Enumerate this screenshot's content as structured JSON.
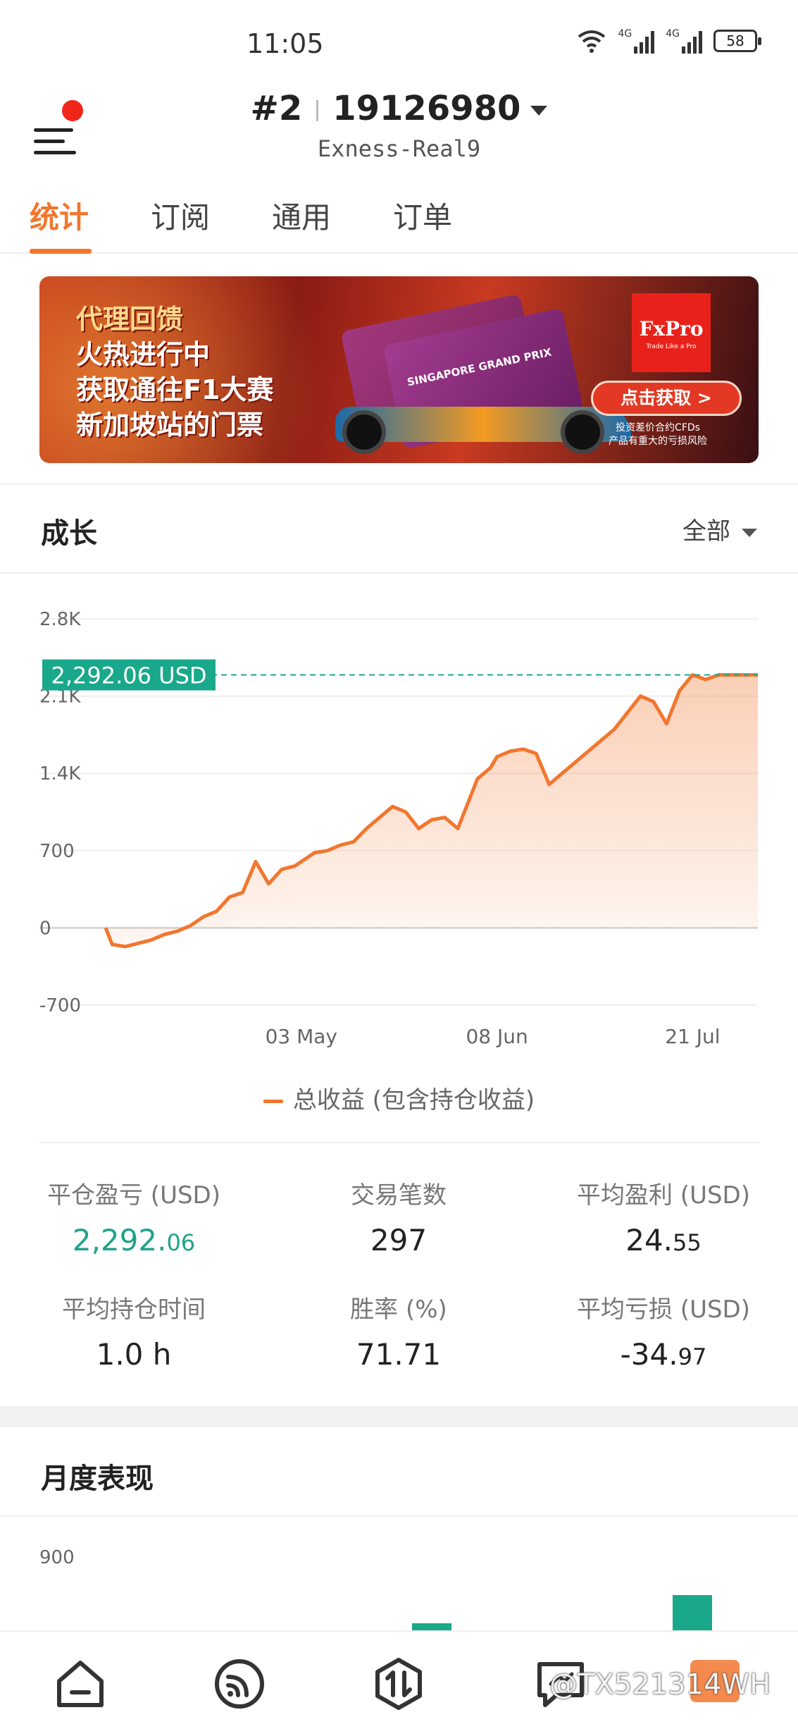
{
  "status_bar": {
    "time": "11:05",
    "battery": "58",
    "network_a": "4G",
    "network_b": "4G"
  },
  "header": {
    "rank": "#2",
    "account": "19126980",
    "server": "Exness-Real9"
  },
  "tabs": [
    {
      "label": "统计",
      "active": true
    },
    {
      "label": "订阅",
      "active": false
    },
    {
      "label": "通用",
      "active": false
    },
    {
      "label": "订单",
      "active": false
    }
  ],
  "banner": {
    "lines": [
      "代理回馈",
      "火热进行中",
      "获取通往F1大赛",
      "新加坡站的门票"
    ],
    "ticket_text": "SINGAPORE GRAND PRIX",
    "brand": "FxPro",
    "brand_tagline": "Trade Like a Pro",
    "cta": "点击获取 >",
    "risk_line1": "投资差价合约CFDs",
    "risk_line2": "产品有重大的亏损风险"
  },
  "growth": {
    "title": "成长",
    "filter": "全部"
  },
  "chart_data": {
    "type": "area",
    "title": "",
    "ylabel": "",
    "xlabel": "",
    "ylim": [
      -700,
      2800
    ],
    "yticks": [
      "2.8K",
      "2.1K",
      "1.4K",
      "700",
      "0",
      "-700"
    ],
    "ytick_values": [
      2800,
      2100,
      1400,
      700,
      0,
      -700
    ],
    "xticks": [
      "03 May",
      "08 Jun",
      "21 Jul"
    ],
    "xtick_positions": [
      0.3,
      0.6,
      0.9
    ],
    "current_value_label": "2,292.06 USD",
    "current_value": 2292.06,
    "legend": [
      "总收益 (包含持仓收益)"
    ],
    "series": [
      {
        "name": "总收益 (包含持仓收益)",
        "color": "#f2762e",
        "x": [
          0,
          0.01,
          0.03,
          0.05,
          0.07,
          0.09,
          0.11,
          0.13,
          0.15,
          0.17,
          0.19,
          0.21,
          0.23,
          0.25,
          0.27,
          0.29,
          0.3,
          0.31,
          0.32,
          0.34,
          0.36,
          0.38,
          0.4,
          0.42,
          0.44,
          0.46,
          0.48,
          0.5,
          0.52,
          0.54,
          0.56,
          0.57,
          0.59,
          0.6,
          0.62,
          0.64,
          0.66,
          0.68,
          0.7,
          0.72,
          0.74,
          0.76,
          0.78,
          0.8,
          0.82,
          0.84,
          0.86,
          0.88,
          0.9,
          0.92,
          0.94,
          0.95,
          0.96,
          0.97,
          0.98,
          1.0
        ],
        "y": [
          0,
          -150,
          -170,
          -140,
          -110,
          -60,
          -30,
          20,
          100,
          150,
          280,
          320,
          600,
          400,
          530,
          560,
          600,
          640,
          680,
          700,
          750,
          780,
          900,
          1000,
          1100,
          1050,
          900,
          980,
          1000,
          900,
          1200,
          1350,
          1450,
          1550,
          1600,
          1620,
          1580,
          1300,
          1400,
          1500,
          1600,
          1700,
          1800,
          1950,
          2100,
          2050,
          1850,
          2150,
          2292.06,
          2250,
          2292.06,
          2292.06,
          2292.06,
          2292.06,
          2292.06,
          2292.06
        ]
      }
    ]
  },
  "stats": [
    {
      "label": "平仓盈亏 (USD)",
      "int": "2,292.",
      "dec": "06",
      "accent": "green"
    },
    {
      "label": "交易笔数",
      "int": "297",
      "dec": "",
      "accent": "none"
    },
    {
      "label": "平均盈利 (USD)",
      "int": "24.",
      "dec": "55",
      "accent": "none"
    },
    {
      "label": "平均持仓时间",
      "int": "1.0 h",
      "dec": "",
      "accent": "none"
    },
    {
      "label": "胜率 (%)",
      "int": "71.71",
      "dec": "",
      "accent": "none"
    },
    {
      "label": "平均亏损 (USD)",
      "int": "-34.",
      "dec": "97",
      "accent": "none"
    }
  ],
  "monthly": {
    "title": "月度表现",
    "y_tick": "900"
  },
  "bottom_nav": {
    "items": [
      "home-icon",
      "signal-icon",
      "trade-icon",
      "chat-icon",
      "profile-icon"
    ],
    "watermark": "@TX521314WH"
  },
  "colors": {
    "accent": "#f2762e",
    "green": "#1aa88b",
    "red_dot": "#f0261a"
  }
}
